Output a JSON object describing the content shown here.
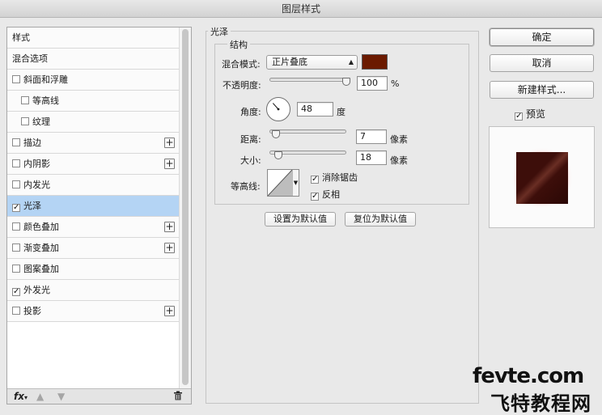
{
  "window": {
    "title": "图层样式"
  },
  "styles": {
    "items": [
      {
        "label": "样式",
        "checkbox": false,
        "checked": false,
        "indent": false,
        "plus": false,
        "selected": false
      },
      {
        "label": "混合选项",
        "checkbox": false,
        "checked": false,
        "indent": false,
        "plus": false,
        "selected": false
      },
      {
        "label": "斜面和浮雕",
        "checkbox": true,
        "checked": false,
        "indent": false,
        "plus": false,
        "selected": false
      },
      {
        "label": "等高线",
        "checkbox": true,
        "checked": false,
        "indent": true,
        "plus": false,
        "selected": false
      },
      {
        "label": "纹理",
        "checkbox": true,
        "checked": false,
        "indent": true,
        "plus": false,
        "selected": false
      },
      {
        "label": "描边",
        "checkbox": true,
        "checked": false,
        "indent": false,
        "plus": true,
        "selected": false
      },
      {
        "label": "内阴影",
        "checkbox": true,
        "checked": false,
        "indent": false,
        "plus": true,
        "selected": false
      },
      {
        "label": "内发光",
        "checkbox": true,
        "checked": false,
        "indent": false,
        "plus": false,
        "selected": false
      },
      {
        "label": "光泽",
        "checkbox": true,
        "checked": true,
        "indent": false,
        "plus": false,
        "selected": true
      },
      {
        "label": "颜色叠加",
        "checkbox": true,
        "checked": false,
        "indent": false,
        "plus": true,
        "selected": false
      },
      {
        "label": "渐变叠加",
        "checkbox": true,
        "checked": false,
        "indent": false,
        "plus": true,
        "selected": false
      },
      {
        "label": "图案叠加",
        "checkbox": true,
        "checked": false,
        "indent": false,
        "plus": false,
        "selected": false
      },
      {
        "label": "外发光",
        "checkbox": true,
        "checked": true,
        "indent": false,
        "plus": false,
        "selected": false
      },
      {
        "label": "投影",
        "checkbox": true,
        "checked": false,
        "indent": false,
        "plus": true,
        "selected": false
      }
    ],
    "toolbar": {
      "fx": "fx",
      "up_icon": "arrow-up-icon",
      "down_icon": "arrow-down-icon",
      "delete_icon": "trash-icon"
    }
  },
  "satin": {
    "group_title": "光泽",
    "structure_title": "结构",
    "blend_mode_label": "混合模式:",
    "blend_mode_value": "正片叠底",
    "color": "#6b1a00",
    "opacity_label": "不透明度:",
    "opacity_value": "100",
    "opacity_unit": "%",
    "opacity_fraction": 1.0,
    "angle_label": "角度:",
    "angle_value": "48",
    "angle_degrees": 48,
    "angle_unit": "度",
    "distance_label": "距离:",
    "distance_value": "7",
    "distance_fraction": 0.03,
    "distance_unit": "像素",
    "size_label": "大小:",
    "size_value": "18",
    "size_fraction": 0.07,
    "size_unit": "像素",
    "contour_label": "等高线:",
    "antialias_label": "消除锯齿",
    "antialias_checked": true,
    "invert_label": "反相",
    "invert_checked": true,
    "make_default_label": "设置为默认值",
    "reset_default_label": "复位为默认值"
  },
  "actions": {
    "ok_label": "确定",
    "cancel_label": "取消",
    "new_style_label": "新建样式...",
    "preview_label": "预览",
    "preview_checked": true
  },
  "watermark": {
    "line1": "fevte.com",
    "line2": "飞特教程网"
  }
}
